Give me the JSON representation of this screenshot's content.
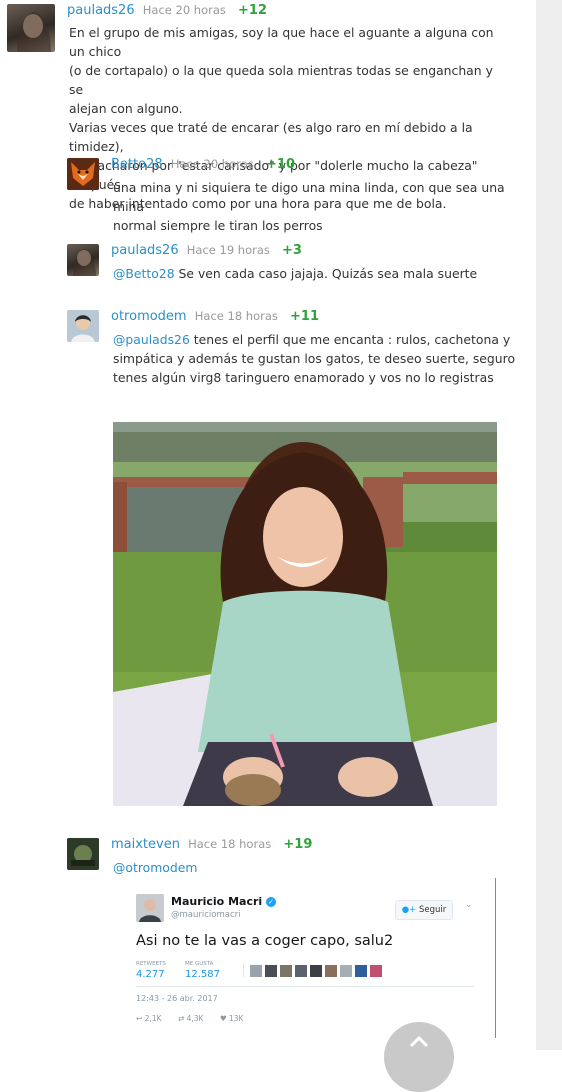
{
  "comments": [
    {
      "user": "paulads26",
      "time": "Hace 20 horas",
      "votes": "+12",
      "lines": [
        "En el grupo de mis amigas, soy la que hace el aguante a alguna con un chico",
        "(o de cortapalo) o la que queda sola mientras todas se enganchan y se",
        "alejan con alguno.",
        "Varias veces que traté de encarar (es algo raro en mí debido a la timidez),",
        "me tacharon por \"estar cansado\" y por \"dolerle mucho la cabeza\" después",
        "de haber intentado como por una hora para que me de bola."
      ]
    },
    {
      "user": "Betto28",
      "time": "Hace 20 horas",
      "votes": "+10",
      "lines": [
        "una mina y ni siquiera te digo una mina linda, con que sea una mina",
        "normal siempre le tiran los perros"
      ]
    },
    {
      "user": "paulads26",
      "time": "Hace 19 horas",
      "votes": "+3",
      "mention": "@Betto28",
      "text": " Se ven cada caso jajaja. Quizás sea mala suerte"
    },
    {
      "user": "otromodem",
      "time": "Hace 18 horas",
      "votes": "+11",
      "mention": "@paulads26",
      "line1": " tenes el perfil que me encanta : rulos, cachetona y",
      "lines": [
        "simpática y además te gustan los gatos, te deseo suerte, seguro",
        "tenes algún virg8 taringuero enamorado y vos no lo registras"
      ]
    },
    {
      "user": "maixteven",
      "time": "Hace 18 horas",
      "votes": "+19",
      "mention": "@otromodem"
    }
  ],
  "tweet": {
    "name": "Mauricio Macri",
    "handle": "@mauriciomacri",
    "follow_label": "Seguir",
    "text": "Asi no te la vas a coger capo, salu2",
    "retweets_label": "RETWEETS",
    "retweets": "4.277",
    "likes_label": "ME GUSTA",
    "likes": "12.587",
    "timestamp": "12:43 - 26 abr. 2017",
    "reply_count": "2,1K",
    "retweet_count": "4,3K",
    "like_count": "13K"
  },
  "colors": {
    "username": "#2b8fc9",
    "votes": "#2fa23a",
    "time": "#9a9a9a",
    "verified": "#1da1f2"
  }
}
